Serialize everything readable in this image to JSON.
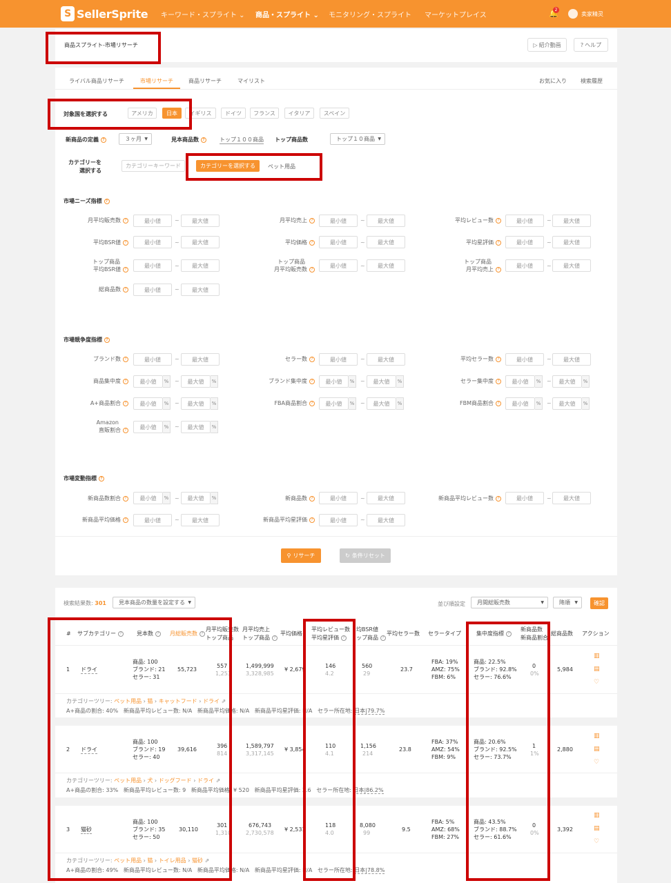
{
  "header": {
    "logo_text": "SellerSprite",
    "nav": [
      "キーワード・スプライト ⌄",
      "商品・スプライト ⌄",
      "モニタリング・スプライト",
      "マーケットプレイス"
    ],
    "notification_count": "2",
    "username": "卖家精灵"
  },
  "page": {
    "breadcrumb": "商品スプライト-市場リサーチ",
    "intro_video": "紹介動画",
    "help": "ヘルプ",
    "tabs": [
      "ライバル商品リサーチ",
      "市場リサーチ",
      "商品リサーチ",
      "マイリスト"
    ],
    "right_links": [
      "お気に入り",
      "検索履歴"
    ]
  },
  "filters": {
    "country_label": "対象国を選択する",
    "countries": [
      "アメリカ",
      "日本",
      "イギリス",
      "ドイツ",
      "フランス",
      "イタリア",
      "スペイン"
    ],
    "selected_country": "日本",
    "new_def_label": "新商品の定義",
    "new_def_value": "３ヶ月",
    "sample_label": "見本商品数",
    "sample_value": "トップ１００商品",
    "top_label": "トップ商品数",
    "top_value": "トップ１０商品",
    "category_label_1": "カテゴリーを",
    "category_label_2": "選択する",
    "category_placeholder": "カテゴリーキーワード",
    "category_button": "カテゴリーを選択する",
    "category_selected": "ペット用品",
    "min": "最小値",
    "max": "最大値",
    "pct": "%",
    "tilde": "~",
    "demand_title": "市場ニーズ指標",
    "demand": {
      "monthly_sales": "月平均販売数",
      "monthly_revenue": "月平均売上",
      "review_count": "平均レビュー数",
      "bsr": "平均BSR値",
      "price": "平均価格",
      "rating": "平均星評価",
      "top_bsr_1": "トップ商品",
      "top_bsr_2": "平均BSR値",
      "top_sales_1": "トップ商品",
      "top_sales_2": "月平均販売数",
      "top_rev_1": "トップ商品",
      "top_rev_2": "月平均売上",
      "total": "総商品数"
    },
    "competition_title": "市場競争度指標",
    "competition": {
      "brands": "ブランド数",
      "sellers": "セラー数",
      "avg_sellers": "平均セラー数",
      "prod_conc": "商品集中度",
      "brand_conc": "ブランド集中度",
      "seller_conc": "セラー集中度",
      "aplus": "A+商品割合",
      "fba": "FBA商品割合",
      "fbm": "FBM商品割合",
      "amazon_1": "Amazon",
      "amazon_2": "直販割合"
    },
    "change_title": "市場変動指標",
    "change": {
      "new_ratio": "新商品数割合",
      "new_count": "新商品数",
      "new_reviews": "新商品平均レビュー数",
      "new_price": "新商品平均価格",
      "new_rating": "新商品平均星評価"
    },
    "research_button": "リサーチ",
    "reset_button": "条件リセット"
  },
  "results": {
    "count_label": "検索結果数:",
    "count": "301",
    "sample_select": "見本商品の数量を設定する",
    "sort_label": "並び順設定",
    "sort_value": "月間総販売数",
    "order_value": "降順",
    "confirm": "確認",
    "columns": {
      "num": "#",
      "subcat": "サブカテゴリー",
      "samples": "見本数",
      "total_sales": "月総販売数",
      "avg_sales_1": "月平均販売数",
      "avg_sales_2": "トップ商品",
      "avg_rev_1": "月平均売上",
      "avg_rev_2": "トップ商品",
      "price": "平均価格",
      "review_1": "平均レビュー数",
      "review_2": "平均星評価",
      "bsr_1": "均BSR値",
      "bsr_2": "ップ商品",
      "sellers": "平均セラー数",
      "seller_type": "セラータイプ",
      "conc": "集中度指標",
      "new_1": "新商品数",
      "new_2": "新商品割合",
      "total": "総商品数",
      "action": "アクション"
    },
    "rows": [
      {
        "num": "1",
        "name": "ドライ",
        "s1": "商品: 100",
        "s2": "ブランド: 21",
        "s3": "セラー: 31",
        "total_sales": "55,723",
        "avg_sales": "557",
        "avg_sales_top": "1,253",
        "avg_rev": "1,499,999",
        "avg_rev_top": "3,328,985",
        "price": "¥ 2,679",
        "reviews": "146",
        "rating": "4.2",
        "bsr": "560",
        "bsr_top": "29",
        "sellers": "23.7",
        "fba": "FBA: 19%",
        "amz": "AMZ: 75%",
        "fbm": "FBM: 6%",
        "c1": "商品: 22.5%",
        "c2": "ブランド: 92.8%",
        "c3": "セラー: 76.6%",
        "new": "0",
        "new_pct": "0%",
        "total": "5,984",
        "tree_label": "カテゴリーツリー:",
        "tree": [
          "ペット用品",
          "猫",
          "キャットフード",
          "ドライ"
        ],
        "meta_a": "A+商品の割合: 40%",
        "meta_b": "新商品平均レビュー数: N/A",
        "meta_c": "新商品平均価格: N/A",
        "meta_d": "新商品平均星評価: N/A",
        "meta_e": "セラー所在地:",
        "meta_f": "日本|79.7%"
      },
      {
        "num": "2",
        "name": "ドライ",
        "s1": "商品: 100",
        "s2": "ブランド: 19",
        "s3": "セラー: 40",
        "total_sales": "39,616",
        "avg_sales": "396",
        "avg_sales_top": "814",
        "avg_rev": "1,589,797",
        "avg_rev_top": "3,317,145",
        "price": "¥ 3,854",
        "reviews": "110",
        "rating": "4.1",
        "bsr": "1,156",
        "bsr_top": "214",
        "sellers": "23.8",
        "fba": "FBA: 37%",
        "amz": "AMZ: 54%",
        "fbm": "FBM: 9%",
        "c1": "商品: 20.6%",
        "c2": "ブランド: 92.5%",
        "c3": "セラー: 73.7%",
        "new": "1",
        "new_pct": "1%",
        "total": "2,880",
        "tree_label": "カテゴリーツリー:",
        "tree": [
          "ペット用品",
          "犬",
          "ドッグフード",
          "ドライ"
        ],
        "meta_a": "A+商品の割合: 33%",
        "meta_b": "新商品平均レビュー数: 9",
        "meta_c": "新商品平均価格: ¥ 520",
        "meta_d": "新商品平均星評価: 3.6",
        "meta_e": "セラー所在地:",
        "meta_f": "日本|86.2%"
      },
      {
        "num": "3",
        "name": "猫砂",
        "s1": "商品: 100",
        "s2": "ブランド: 35",
        "s3": "セラー: 50",
        "total_sales": "30,110",
        "avg_sales": "301",
        "avg_sales_top": "1,310",
        "avg_rev": "676,743",
        "avg_rev_top": "2,730,578",
        "price": "¥ 2,531",
        "reviews": "118",
        "rating": "4.0",
        "bsr": "8,080",
        "bsr_top": "99",
        "sellers": "9.5",
        "fba": "FBA: 5%",
        "amz": "AMZ: 68%",
        "fbm": "FBM: 27%",
        "c1": "商品: 43.5%",
        "c2": "ブランド: 88.7%",
        "c3": "セラー: 61.6%",
        "new": "0",
        "new_pct": "0%",
        "total": "3,392",
        "tree_label": "カテゴリーツリー:",
        "tree": [
          "ペット用品",
          "猫",
          "トイレ用品",
          "猫砂"
        ],
        "meta_a": "A+商品の割合: 49%",
        "meta_b": "新商品平均レビュー数: N/A",
        "meta_c": "新商品平均価格: N/A",
        "meta_d": "新商品平均星評価: N/A",
        "meta_e": "セラー所在地:",
        "meta_f": "日本|78.8%"
      }
    ]
  },
  "colors": {
    "accent": "#f7932f",
    "highlight_box": "#cc0000"
  }
}
